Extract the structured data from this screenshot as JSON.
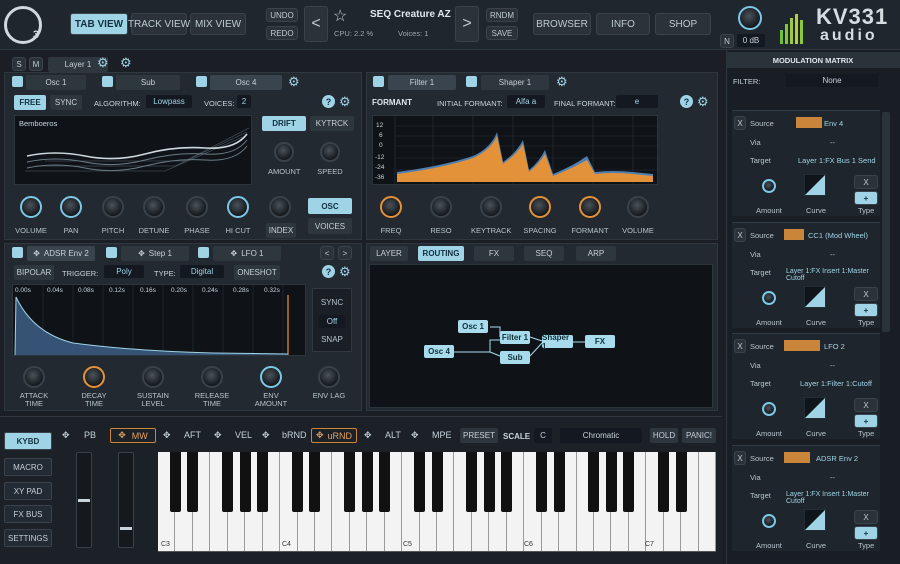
{
  "header": {
    "logo_text": "3",
    "tab_view": "TAB VIEW",
    "track_view": "TRACK VIEW",
    "mix_view": "MIX VIEW",
    "undo": "UNDO",
    "redo": "REDO",
    "prev": "<",
    "next": ">",
    "preset_name": "SEQ Creature AZ",
    "cpu": "CPU: 2.2 %",
    "voices": "Voices: 1",
    "rndm": "RNDM",
    "save": "SAVE",
    "browser": "BROWSER",
    "info": "INFO",
    "shop": "SHOP",
    "n_label": "N",
    "volume_db": "0 dB",
    "brand_top": "KV331",
    "brand_bottom": "audio"
  },
  "layer": {
    "s_label": "S",
    "m_label": "M",
    "name": "Layer 1"
  },
  "osc_tabs": [
    "Osc 1",
    "Sub",
    "Osc 4"
  ],
  "osc": {
    "free": "FREE",
    "sync": "SYNC",
    "algorithm_label": "ALGORITHM:",
    "algorithm_value": "Lowpass",
    "voices_label": "VOICES:",
    "voices_value": "2",
    "wave_name": "Bemboeros",
    "drift": "DRIFT",
    "keytrack": "KYTRCK",
    "amount": "AMOUNT",
    "speed": "SPEED",
    "knobs": [
      "VOLUME",
      "PAN",
      "PITCH",
      "DETUNE",
      "PHASE",
      "HI CUT",
      "INDEX"
    ],
    "osc_btn": "OSC",
    "voices_btn": "VOICES"
  },
  "filter_tabs": [
    "Filter 1",
    "Shaper 1"
  ],
  "filter": {
    "type": "FORMANT",
    "initial_label": "INITIAL FORMANT:",
    "initial_value": "Alfa a",
    "final_label": "FINAL FORMANT:",
    "final_value": "e",
    "db_ticks": [
      "12",
      "6",
      "0",
      "-12",
      "-24",
      "-36"
    ],
    "knobs": [
      "FREQ",
      "RESO",
      "KEYTRACK",
      "SPACING",
      "FORMANT",
      "VOLUME"
    ]
  },
  "env_tabs": [
    "ADSR Env 2",
    "Step 1",
    "LFO 1"
  ],
  "env": {
    "bipolar": "BIPOLAR",
    "trigger_label": "TRIGGER:",
    "trigger_value": "Poly",
    "type_label": "TYPE:",
    "type_value": "Digital",
    "oneshot": "ONESHOT",
    "time_ticks": [
      "0.00s",
      "0.04s",
      "0.08s",
      "0.12s",
      "0.16s",
      "0.20s",
      "0.24s",
      "0.28s",
      "0.32s"
    ],
    "sync": "SYNC",
    "off": "Off",
    "snap": "SNAP",
    "knobs": [
      "ATTACK TIME",
      "DECAY TIME",
      "SUSTAIN LEVEL",
      "RELEASE TIME",
      "ENV AMOUNT",
      "ENV LAG"
    ]
  },
  "routing_tabs": [
    "LAYER",
    "ROUTING",
    "FX",
    "SEQ",
    "ARP"
  ],
  "routing": {
    "nodes": [
      "Osc 1",
      "Filter 1",
      "Osc 4",
      "Sub",
      "Shaper 1",
      "FX"
    ]
  },
  "sidebar": [
    "KYBD",
    "MACRO",
    "XY PAD",
    "FX BUS",
    "SETTINGS"
  ],
  "controls": {
    "pb": "PB",
    "mw": "MW",
    "aft": "AFT",
    "vel": "VEL",
    "brnd": "bRND",
    "urnd": "uRND",
    "alt": "ALT",
    "mpe": "MPE",
    "preset": "PRESET",
    "scale": "SCALE",
    "scale_key": "C",
    "scale_type": "Chromatic",
    "hold": "HOLD",
    "panic": "PANIC!"
  },
  "keyboard": {
    "octaves": [
      "C3",
      "C4",
      "C5",
      "C6",
      "C7"
    ]
  },
  "modmatrix": {
    "title": "MODULATION MATRIX",
    "filter_label": "FILTER:",
    "filter_value": "None",
    "slots": [
      {
        "x": "X",
        "source_label": "Source",
        "source": "Env 4",
        "via_label": "Via",
        "via": "--",
        "target_label": "Target",
        "target": "Layer 1:FX Bus 1 Send",
        "amount": "Amount",
        "curve": "Curve",
        "type": "Type"
      },
      {
        "x": "X",
        "source_label": "Source",
        "source": "CC1 (Mod Wheel)",
        "via_label": "Via",
        "via": "--",
        "target_label": "Target",
        "target": "Layer 1:FX Insert 1:Master Cutoff",
        "amount": "Amount",
        "curve": "Curve",
        "type": "Type"
      },
      {
        "x": "X",
        "source_label": "Source",
        "source": "LFO 2",
        "via_label": "Via",
        "via": "--",
        "target_label": "Target",
        "target": "Layer 1:Filter 1:Cutoff",
        "amount": "Amount",
        "curve": "Curve",
        "type": "Type"
      },
      {
        "x": "X",
        "source_label": "Source",
        "source": "ADSR Env 2",
        "via_label": "Via",
        "via": "--",
        "target_label": "Target",
        "target": "Layer 1:FX Insert 1:Master Cutoff",
        "amount": "Amount",
        "curve": "Curve",
        "type": "Type"
      }
    ]
  },
  "colors": {
    "accent": "#9fd4e6",
    "orange": "#e4923a",
    "bg": "#1b1f25"
  }
}
